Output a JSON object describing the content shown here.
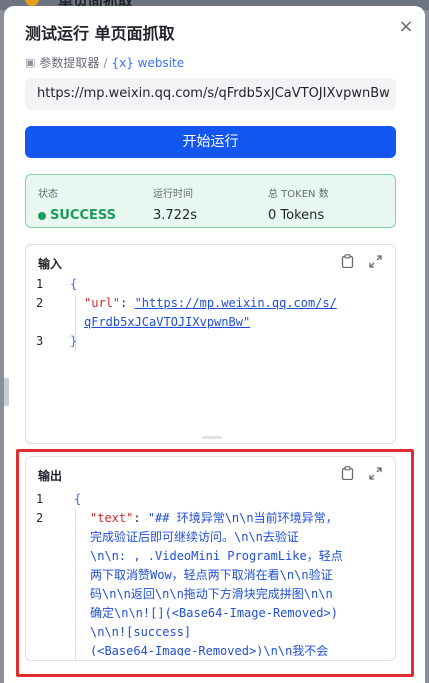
{
  "background_title": "单页面抓取",
  "dialog": {
    "title": "测试运行 单页面抓取",
    "close_icon": "×"
  },
  "breadcrumb": {
    "item1": "参数提取器",
    "sep": "/",
    "item2": "{x} website"
  },
  "url_value": "https://mp.weixin.qq.com/s/qFrdb5xJCaVTOJIXvpwnBw",
  "run_button": "开始运行",
  "status": {
    "status_label": "状态",
    "status_value": "SUCCESS",
    "time_label": "运行时间",
    "time_value": "3.722s",
    "token_label": "总 TOKEN 数",
    "token_value": "0 Tokens"
  },
  "input": {
    "title": "输入",
    "line_numbers": [
      "1",
      "2",
      "3"
    ],
    "open_brace": "{",
    "key": "\"url\"",
    "colon": ": ",
    "value_line1": "\"https://mp.weixin.qq.com/s/",
    "value_line2": "qFrdb5xJCaVTOJIXvpwnBw\"",
    "close_brace": "}"
  },
  "output": {
    "title": "输出",
    "line_numbers": [
      "1",
      "2"
    ],
    "open_brace": "{",
    "key": "\"text\"",
    "colon": ": ",
    "lines": [
      "\"## 环境异常\\n\\n当前环境异常，",
      "完成验证后即可继续访问。\\n\\n去验证",
      "\\n\\n: , .VideoMini ProgramLike，轻点",
      "两下取消赞Wow，轻点两下取消在看\\n\\n验证",
      "码\\n\\n返回\\n\\n拖动下方滑块完成拼图\\n\\n",
      "确定\\n\\n![](<Base64-Image-Removed>)",
      "\\n\\n![success]",
      "(<Base64-Image-Removed>)\\n\\n我不会"
    ]
  },
  "colors": {
    "accent": "#1456f0",
    "success": "#1a9d5c",
    "highlight": "#e02d2d"
  },
  "icons": {
    "copy": "clipboard-icon",
    "expand": "expand-icon"
  }
}
